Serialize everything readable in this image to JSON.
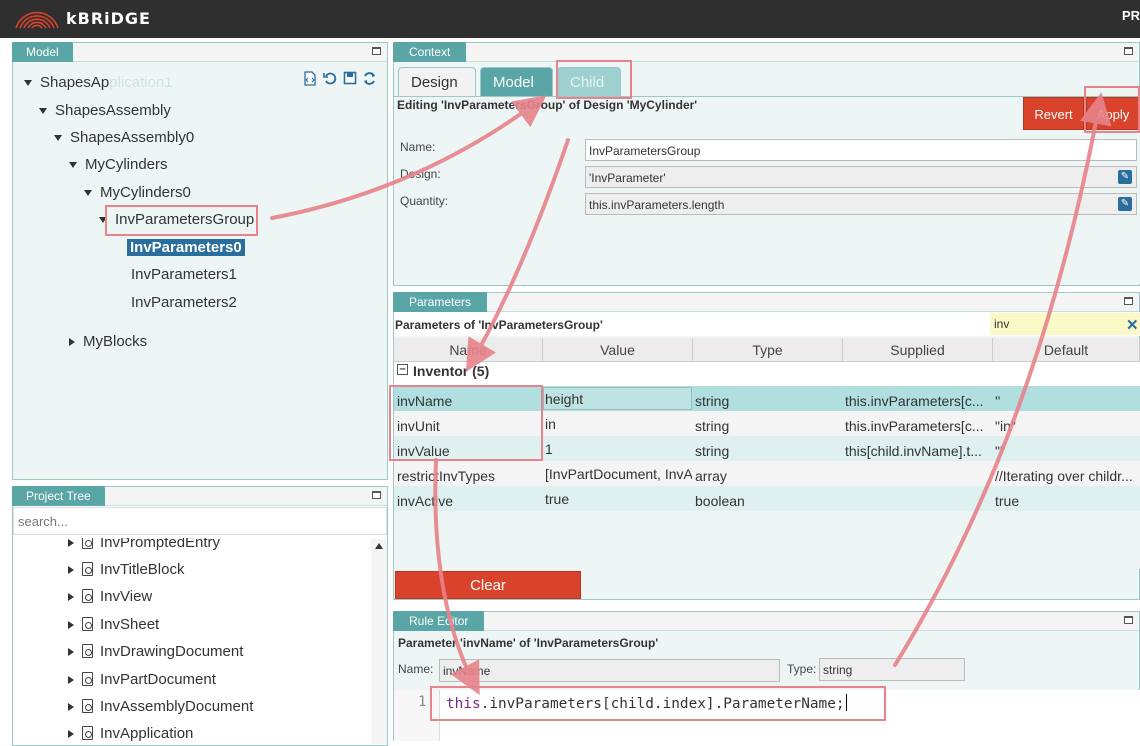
{
  "app": {
    "brand": "kBRiDGE",
    "topright": "PR"
  },
  "model": {
    "tab": "Model",
    "tree": [
      {
        "label": "ShapesApplication1",
        "expanded": true
      },
      {
        "label": "ShapesAssembly",
        "expanded": true
      },
      {
        "label": "ShapesAssembly0",
        "expanded": true
      },
      {
        "label": "MyCylinders",
        "expanded": true
      },
      {
        "label": "MyCylinders0",
        "expanded": true
      },
      {
        "label": "InvParametersGroup",
        "expanded": true
      },
      {
        "label": "InvParameters0",
        "selected": true
      },
      {
        "label": "InvParameters1"
      },
      {
        "label": "InvParameters2"
      },
      {
        "label": "MyBlocks",
        "expanded": false
      }
    ]
  },
  "project_tree": {
    "tab": "Project Tree",
    "search_placeholder": "search...",
    "items": [
      "InvPromptedEntry",
      "InvTitleBlock",
      "InvView",
      "InvSheet",
      "InvDrawingDocument",
      "InvPartDocument",
      "InvAssemblyDocument",
      "InvApplication"
    ]
  },
  "context": {
    "tab": "Context",
    "tabs": [
      "Design",
      "Model",
      "Child"
    ],
    "editing_title": "Editing 'InvParametersGroup' of Design 'MyCylinder'",
    "revert": "Revert",
    "apply": "Apply",
    "name_label": "Name:",
    "name_value": "InvParametersGroup",
    "design_label": "Design:",
    "design_value": "'InvParameter'",
    "quantity_label": "Quantity:",
    "quantity_value": "this.invParameters.length"
  },
  "parameters": {
    "tab": "Parameters",
    "title": "Parameters of 'InvParametersGroup'",
    "filter_value": "inv",
    "columns": [
      "Name",
      "Value",
      "Type",
      "Supplied",
      "Default"
    ],
    "group": "Inventor (5)",
    "rows": [
      {
        "name": "invName",
        "value": "height",
        "type": "string",
        "supplied": "this.invParameters[c...",
        "default": "''"
      },
      {
        "name": "invUnit",
        "value": "in",
        "type": "string",
        "supplied": "this.invParameters[c...",
        "default": "\"in\""
      },
      {
        "name": "invValue",
        "value": "1",
        "type": "string",
        "supplied": "this[child.invName].t...",
        "default": "\"\""
      },
      {
        "name": "restrictInvTypes",
        "value": "[InvPartDocument, InvA",
        "type": "array",
        "supplied": "",
        "default": "//Iterating over childr..."
      },
      {
        "name": "invActive",
        "value": "true",
        "type": "boolean",
        "supplied": "",
        "default": "true"
      }
    ],
    "clear": "Clear"
  },
  "rule_editor": {
    "tab": "Rule Editor",
    "title": "Parameter 'invName' of 'InvParametersGroup'",
    "name_label": "Name:",
    "name_value": "invName",
    "type_label": "Type:",
    "type_value": "string",
    "line_number": "1",
    "code_keyword": "this",
    "code_rest": ".invParameters[child.index].ParameterName;"
  },
  "colors": {
    "accent": "#5aa6a6",
    "selected": "#2a6e9e",
    "danger": "#d9432c",
    "annotation": "#e7838a"
  }
}
